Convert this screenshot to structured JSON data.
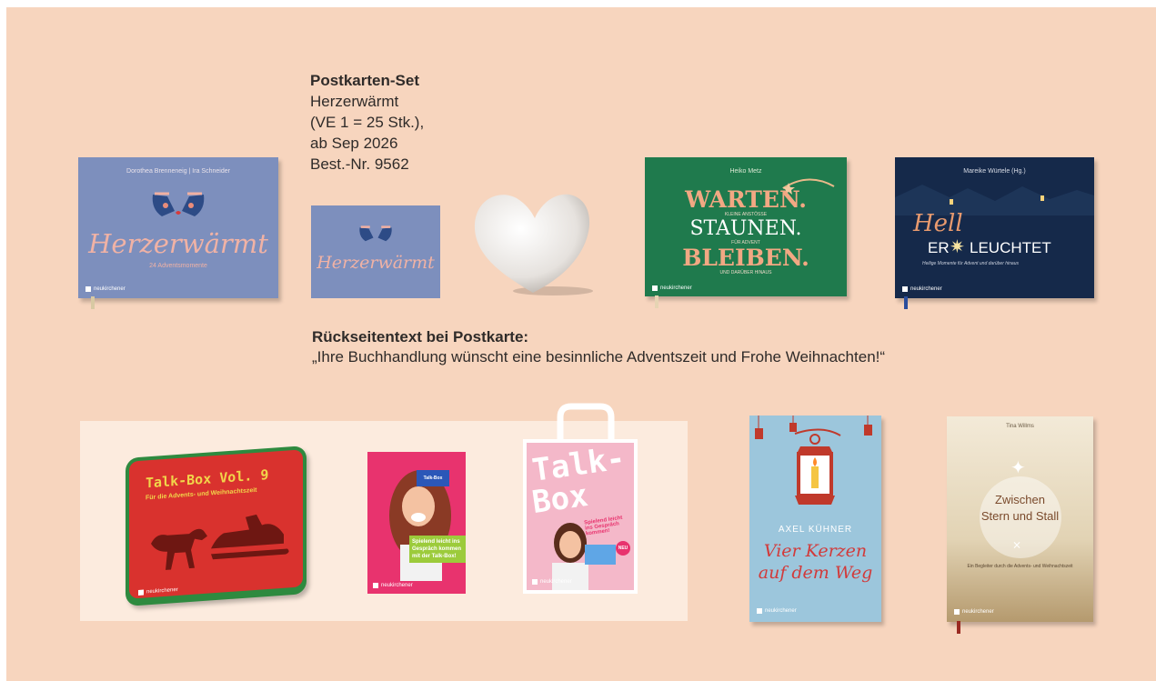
{
  "info": {
    "title": "Postkarten-Set",
    "lines": [
      "Herzerwärmt",
      "(VE 1 = 25 Stk.),",
      "ab Sep 2026",
      "Best.-Nr. 9562"
    ]
  },
  "back_note": {
    "title": "Rückseitentext bei Postkarte:",
    "text": "„Ihre Buchhandlung wünscht eine besinnliche Adventszeit und Frohe Weihnachten!“"
  },
  "products": {
    "herzerwaermt_book": {
      "author": "Dorothea Brenneneig | Ira Schneider",
      "title": "Herzerwärmt",
      "subtitle": "24 Adventsmomente"
    },
    "postcard": {
      "title": "Herzerwärmt"
    },
    "warten_book": {
      "author": "Heiko Metz",
      "line1": "WARTEN.",
      "line2": "STAUNEN.",
      "line3": "BLEIBEN.",
      "small1": "KLEINE ANSTÖSSE",
      "small2": "FÜR ADVENT",
      "small3": "UND DARÜBER HINAUS"
    },
    "hell_book": {
      "author": "Mareike Würtele (Hg.)",
      "title_script": "Hell",
      "title_er": "ER",
      "title_rest": "LEUCHTET",
      "subtitle": "Heilige Momente für Advent und darüber hinaus"
    },
    "talkbox_tin": {
      "title": "Talk-Box Vol. 9",
      "subtitle": "Für die Advents- und Weihnachtszeit"
    },
    "poster": {
      "badge": "Spielend leicht ins Gespräch kommen mit der Talk-Box!",
      "card": "Talk-Box"
    },
    "bag": {
      "title_line1": "Talk-",
      "title_line2": "Box",
      "slogan": "Spielend leicht ins Gespräch kommen!",
      "badge": "NEU"
    },
    "vier_kerzen_book": {
      "author": "AXEL KÜHNER",
      "title_line1": "Vier Kerzen",
      "title_line2": "auf dem Weg"
    },
    "zwischen_book": {
      "author": "Tina Willms",
      "title_line1": "Zwischen",
      "title_line2": "Stern und Stall",
      "subtitle": "Ein Begleiter durch die Advents- und Weihnachtszeit"
    }
  },
  "publisher": "neukirchener",
  "colors": {
    "page_bg": "#f7d5be",
    "panel_bg": "#fcebde",
    "blue_book": "#7c8dbb",
    "green_book": "#1f7a4d",
    "navy_book": "#15294a",
    "red_tin": "#d9322e",
    "pink": "#e8336e",
    "light_blue_book": "#9cc6dc",
    "cream_book": "#e8d8b8"
  },
  "icons": [
    "heart-object",
    "mittens-icon",
    "star-icon",
    "sleigh-icon",
    "lantern-icon",
    "handle-icon"
  ]
}
